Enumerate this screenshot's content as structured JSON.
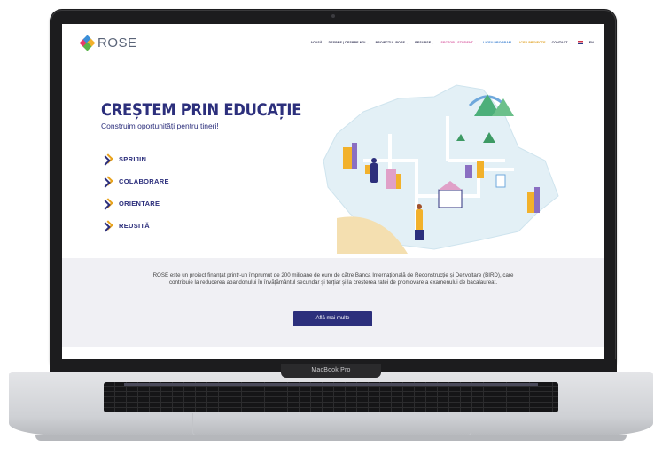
{
  "device": {
    "hinge_label": "MacBook Pro"
  },
  "site": {
    "logo_text": "ROSE",
    "menu": [
      {
        "label": "ACASĂ",
        "style": "plain"
      },
      {
        "label": "DESPRE | DESPRE NOI ⌄",
        "style": "plain"
      },
      {
        "label": "PROIECTUL ROSE ⌄",
        "style": "plain"
      },
      {
        "label": "RESURSE ⌄",
        "style": "plain"
      },
      {
        "label": "SECTOR | STUDENT ⌄",
        "style": "c1"
      },
      {
        "label": "LICEU PROGRAM",
        "style": "c2"
      },
      {
        "label": "LICEU PROIECTE",
        "style": "c3"
      },
      {
        "label": "CONTACT ⌄",
        "style": "plain"
      }
    ],
    "lang": "EN",
    "hero": {
      "title": "CREȘTEM PRIN EDUCAȚIE",
      "subtitle": "Construim oportunități pentru tineri!",
      "pillars": [
        "SPRIJIN",
        "COLABORARE",
        "ORIENTARE",
        "REUȘITĂ"
      ]
    },
    "about": {
      "text": "ROSE este un proiect finanțat printr-un împrumut de 200 milioane de euro de către Banca Internațională de Reconstrucție și Dezvoltare (BIRD), care contribuie la reducerea abandonului în învățământul secundar și terțiar și la creșterea ratei de promovare a examenului de bacalaureat.",
      "cta_label": "Află mai multe"
    }
  },
  "colors": {
    "brand": "#2c2f7c",
    "accent": "#e8a21b",
    "band": "#f0f0f4"
  }
}
